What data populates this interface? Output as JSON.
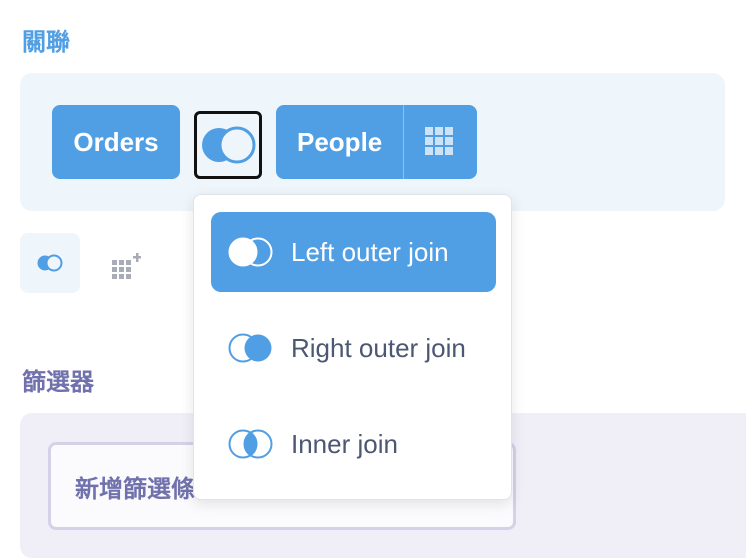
{
  "join_section": {
    "title": "關聯",
    "left_table": "Orders",
    "right_table": "People",
    "join_type_icon": "left-outer-join-icon"
  },
  "join_type_menu": {
    "options": [
      {
        "label": "Left outer join",
        "icon": "left-outer-join-icon",
        "selected": true
      },
      {
        "label": "Right outer join",
        "icon": "right-outer-join-icon",
        "selected": false
      },
      {
        "label": "Inner join",
        "icon": "inner-join-icon",
        "selected": false
      }
    ]
  },
  "filter_section": {
    "title": "篩選器",
    "add_filter_placeholder": "新增篩選條件"
  },
  "colors": {
    "brand": "#509ee3",
    "join_bg": "#eef6fc",
    "filter_accent": "#7172ad",
    "filter_bg": "#f0eff7"
  }
}
